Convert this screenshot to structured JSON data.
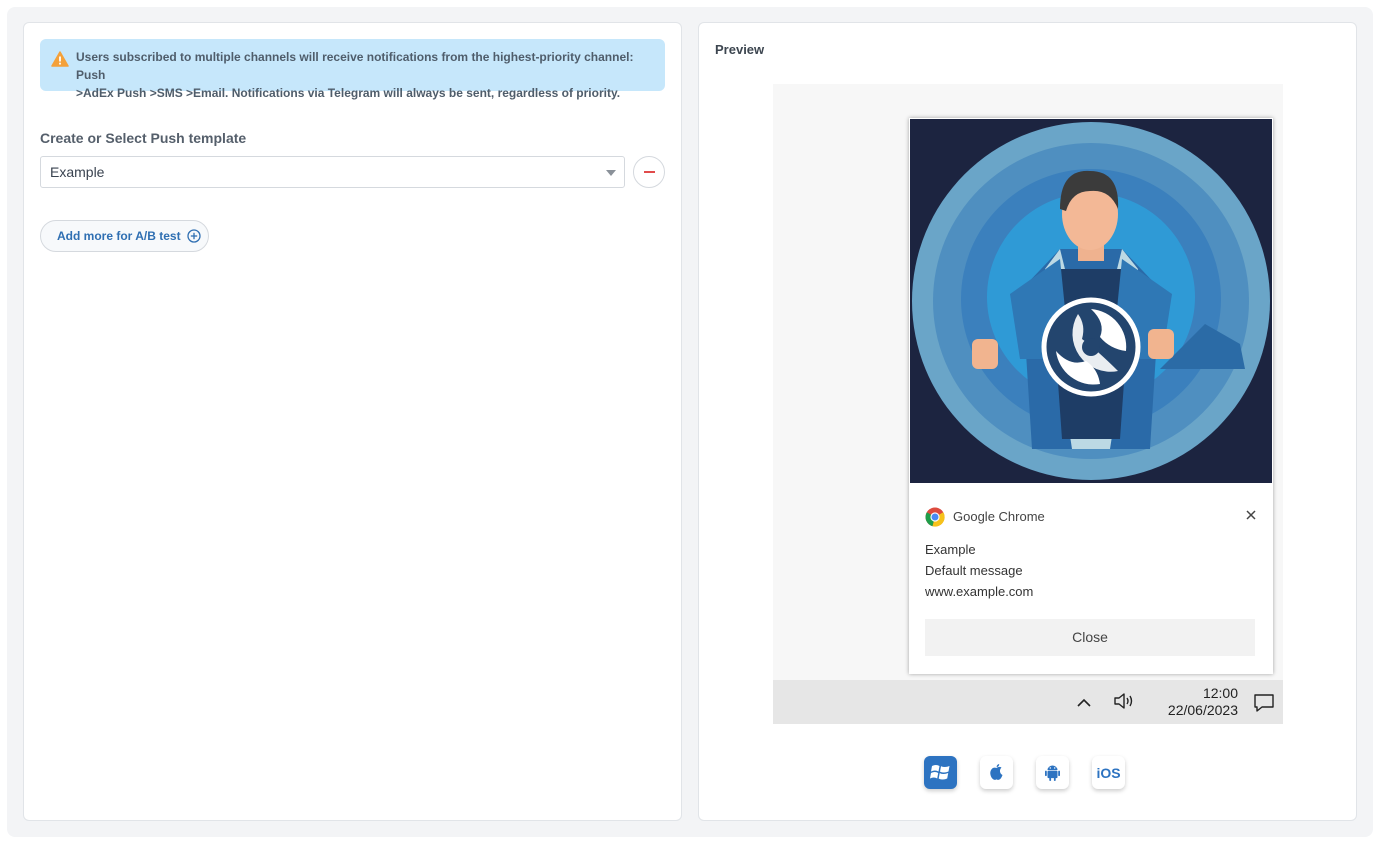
{
  "alert": {
    "line1": "Users subscribed to multiple channels will receive notifications from the highest-priority channel: Push",
    "line2": ">AdEx Push >SMS >Email. Notifications via Telegram will always be sent, regardless of priority.",
    "icon": "warning-icon",
    "color": "#f4a13a"
  },
  "template": {
    "label": "Create or Select Push template",
    "selected": "Example",
    "add_ab_label": "Add more for A/B test"
  },
  "preview": {
    "title": "Preview",
    "notification": {
      "app_name": "Google Chrome",
      "title": "Example",
      "message": "Default message",
      "url": "www.example.com",
      "close_label": "Close"
    },
    "taskbar": {
      "time": "12:00",
      "date": "22/06/2023"
    },
    "platforms": [
      {
        "name": "windows-icon",
        "active": true
      },
      {
        "name": "apple-icon",
        "active": false
      },
      {
        "name": "android-icon",
        "active": false
      },
      {
        "name": "ios",
        "label": "iOS",
        "active": false
      }
    ],
    "accent_color": "#2d73c1"
  }
}
